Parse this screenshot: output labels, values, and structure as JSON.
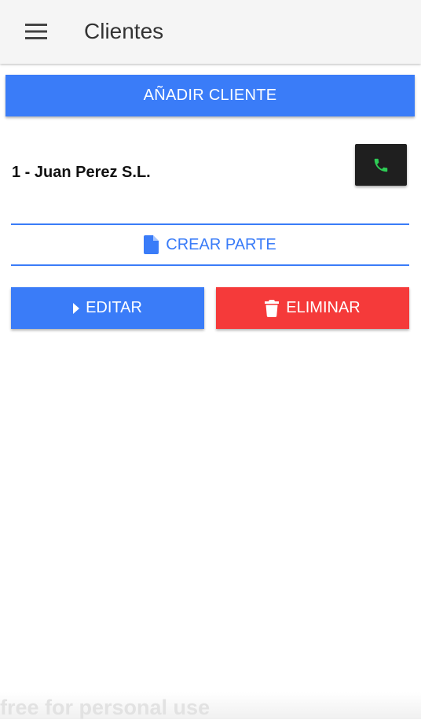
{
  "app": {
    "title": "Clientes",
    "menu_icon": "hamburger-menu-icon"
  },
  "actions": {
    "add_client_label": "AÑADIR CLIENTE"
  },
  "client": {
    "label": "1 - Juan Perez S.L.",
    "call_icon": "phone-icon",
    "create_part_label": "CREAR PARTE",
    "create_part_icon": "document-icon",
    "edit_label": "EDITAR",
    "edit_icon": "caret-right-icon",
    "delete_label": "ELIMINAR",
    "delete_icon": "trash-icon"
  },
  "watermark": {
    "text": "free for personal use"
  },
  "colors": {
    "primary": "#3a7cf8",
    "danger": "#f53a3a",
    "call_button": "#1f1f1f",
    "phone_icon": "#2ecc55",
    "appbar": "#f5f5f5"
  }
}
